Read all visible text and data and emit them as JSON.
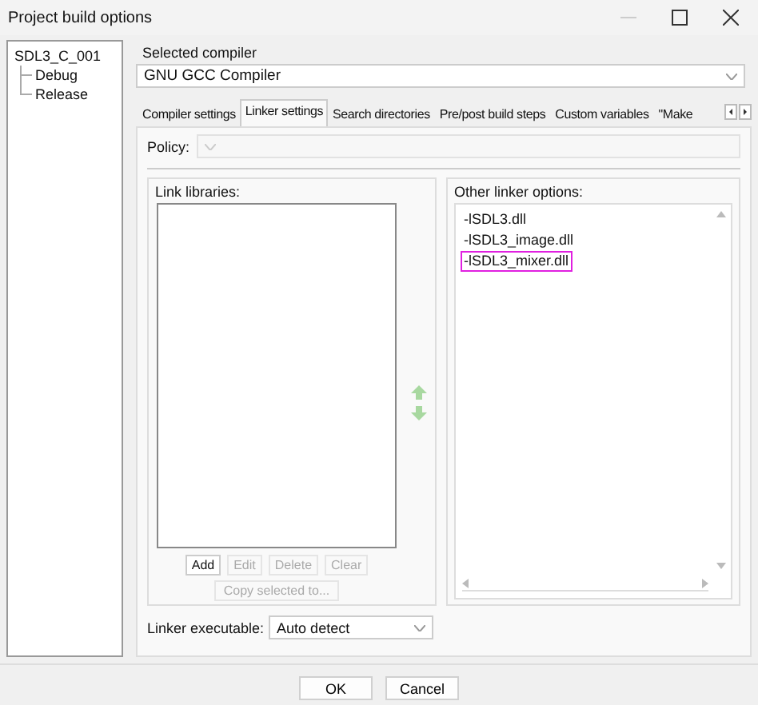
{
  "window": {
    "title": "Project build options"
  },
  "tree": {
    "label": "SDL3_C_001",
    "children": [
      {
        "label": "Debug",
        "selected": false
      },
      {
        "label": "Release",
        "selected": false
      }
    ]
  },
  "compiler": {
    "label": "Selected compiler",
    "value": "GNU GCC Compiler"
  },
  "tabs": [
    {
      "label": "Compiler settings",
      "selected": false
    },
    {
      "label": "Linker settings",
      "selected": true
    },
    {
      "label": "Search directories",
      "selected": false
    },
    {
      "label": "Pre/post build steps",
      "selected": false
    },
    {
      "label": "Custom variables",
      "selected": false
    },
    {
      "label": "\"Make",
      "selected": false
    }
  ],
  "policy": {
    "label": "Policy:"
  },
  "link_libraries": {
    "title": "Link libraries:",
    "buttons": [
      {
        "label": "Add",
        "disabled": false
      },
      {
        "label": "Edit",
        "disabled": true
      },
      {
        "label": "Delete",
        "disabled": true
      },
      {
        "label": "Clear",
        "disabled": true
      }
    ],
    "copy_button": {
      "label": "Copy selected to...",
      "disabled": true
    }
  },
  "other_options": {
    "title": "Other linker options:",
    "lines": [
      {
        "text": "-lSDL3.dll",
        "highlighted": false
      },
      {
        "text": "-lSDL3_image.dll",
        "highlighted": false
      },
      {
        "text": "-lSDL3_mixer.dll",
        "highlighted": true
      }
    ]
  },
  "linker_executable": {
    "label": "Linker executable:",
    "value": "Auto detect"
  },
  "buttons": [
    {
      "label": "OK"
    },
    {
      "label": "Cancel"
    }
  ]
}
